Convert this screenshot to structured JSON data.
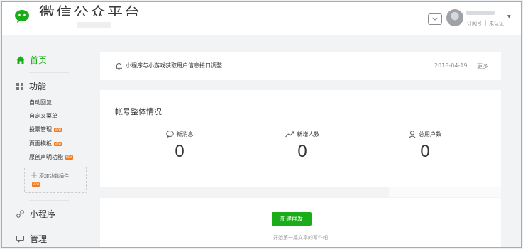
{
  "header": {
    "brand": "微信公众平台",
    "account_type": "订阅号",
    "verify_status": "未认证",
    "mail_icon": "mail-icon",
    "avatar_icon": "avatar"
  },
  "sidebar": {
    "home": {
      "label": "首页",
      "icon": "home-icon",
      "color": "#1aad19"
    },
    "functions": {
      "label": "功能",
      "icon": "grid-icon",
      "items": [
        {
          "label": "自动回复",
          "new": false
        },
        {
          "label": "自定义菜单",
          "new": false
        },
        {
          "label": "投票管理",
          "new": true
        },
        {
          "label": "页面模板",
          "new": true
        },
        {
          "label": "原创声明功能",
          "new": true
        }
      ],
      "add_plugin": {
        "label": "添加功能插件",
        "new": true
      }
    },
    "mini_program": {
      "label": "小程序",
      "icon": "link-icon"
    },
    "manage": {
      "label": "管理",
      "icon": "chat-icon"
    },
    "new_badge_text": "NEW",
    "new_badge_color": "#f37b1d"
  },
  "notice": {
    "text": "小程序与小游戏获取用户信息接口调整",
    "date": "2018-04-19",
    "more": "更多"
  },
  "overview": {
    "title": "帐号整体情况",
    "stats": [
      {
        "label": "新消息",
        "value": "0",
        "icon": "message-icon"
      },
      {
        "label": "新增人数",
        "value": "0",
        "icon": "trend-icon"
      },
      {
        "label": "总用户数",
        "value": "0",
        "icon": "user-icon"
      }
    ]
  },
  "compose": {
    "button": "新建群发",
    "hint": "开始第一篇文章的写作吧"
  }
}
